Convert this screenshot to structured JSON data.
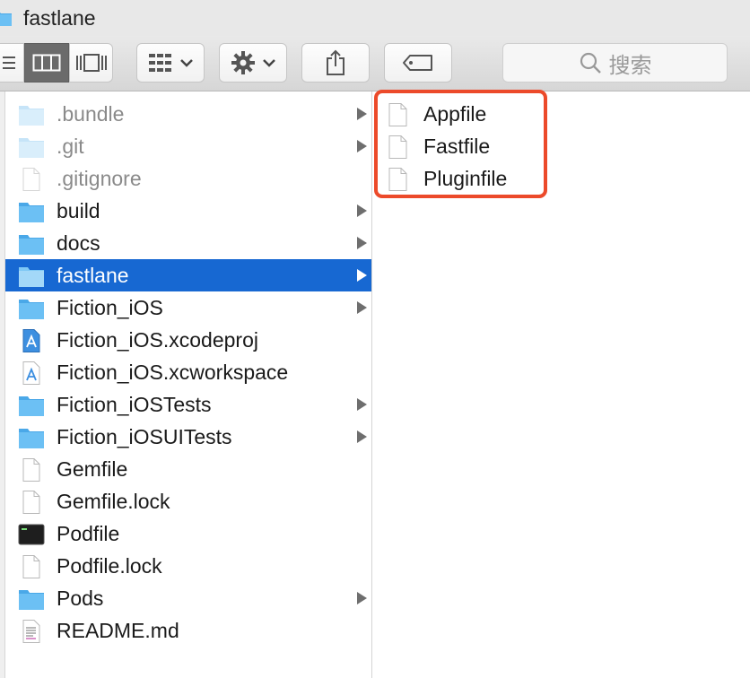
{
  "window": {
    "title": "fastlane"
  },
  "toolbar": {
    "view_modes": [
      "list-view",
      "column-view",
      "cover-flow-view"
    ],
    "active_view": "column-view",
    "search_placeholder": "搜索"
  },
  "column1": {
    "items": [
      {
        "name": ".bundle",
        "icon": "folder-icon",
        "hidden": true,
        "has_children": true
      },
      {
        "name": ".git",
        "icon": "folder-icon",
        "hidden": true,
        "has_children": true
      },
      {
        "name": ".gitignore",
        "icon": "document-icon",
        "hidden": true,
        "has_children": false
      },
      {
        "name": "build",
        "icon": "folder-icon",
        "hidden": false,
        "has_children": true
      },
      {
        "name": "docs",
        "icon": "folder-icon",
        "hidden": false,
        "has_children": true
      },
      {
        "name": "fastlane",
        "icon": "folder-icon",
        "hidden": false,
        "has_children": true,
        "selected": true
      },
      {
        "name": "Fiction_iOS",
        "icon": "folder-icon",
        "hidden": false,
        "has_children": true
      },
      {
        "name": "Fiction_iOS.xcodeproj",
        "icon": "xcode-project-icon",
        "hidden": false,
        "has_children": false
      },
      {
        "name": "Fiction_iOS.xcworkspace",
        "icon": "xcode-workspace-icon",
        "hidden": false,
        "has_children": false
      },
      {
        "name": "Fiction_iOSTests",
        "icon": "folder-icon",
        "hidden": false,
        "has_children": true
      },
      {
        "name": "Fiction_iOSUITests",
        "icon": "folder-icon",
        "hidden": false,
        "has_children": true
      },
      {
        "name": "Gemfile",
        "icon": "document-icon",
        "hidden": false,
        "has_children": false
      },
      {
        "name": "Gemfile.lock",
        "icon": "document-icon",
        "hidden": false,
        "has_children": false
      },
      {
        "name": "Podfile",
        "icon": "terminal-icon",
        "hidden": false,
        "has_children": false
      },
      {
        "name": "Podfile.lock",
        "icon": "document-icon",
        "hidden": false,
        "has_children": false
      },
      {
        "name": "Pods",
        "icon": "folder-icon",
        "hidden": false,
        "has_children": true
      },
      {
        "name": "README.md",
        "icon": "text-document-icon",
        "hidden": false,
        "has_children": false
      }
    ]
  },
  "column2": {
    "items": [
      {
        "name": "Appfile",
        "icon": "document-icon"
      },
      {
        "name": "Fastfile",
        "icon": "document-icon"
      },
      {
        "name": "Pluginfile",
        "icon": "document-icon"
      }
    ]
  },
  "colors": {
    "selection": "#1768d2",
    "highlight_border": "#ec4a2a",
    "folder": "#5cb8f0"
  }
}
